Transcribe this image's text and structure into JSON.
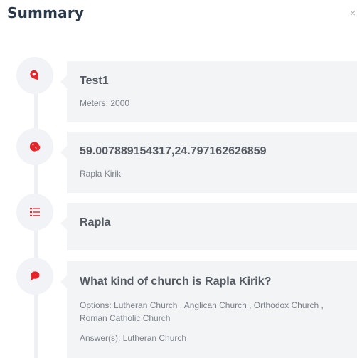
{
  "header": {
    "title": "Summary",
    "close_glyph": "×"
  },
  "colors": {
    "accent": "#e5252a",
    "node_bg": "#f1f3f7",
    "card_bg": "#f2f4f6",
    "line": "#eef0f4"
  },
  "timeline": [
    {
      "icon": "map-pin-icon",
      "title": "Test1",
      "lines": [
        "Meters: 2000"
      ]
    },
    {
      "icon": "globe-icon",
      "title": "59.007889154317,24.797162626859",
      "lines": [
        "Rapla Kirik"
      ]
    },
    {
      "icon": "list-icon",
      "title": "Rapla",
      "lines": []
    },
    {
      "icon": "speech-bubble-icon",
      "title": "What kind of church is Rapla Kirik?",
      "lines": [
        "Options: Lutheran Church , Anglican Church , Orthodox Church , Roman Catholic Church",
        "Answer(s): Lutheran Church"
      ]
    }
  ]
}
